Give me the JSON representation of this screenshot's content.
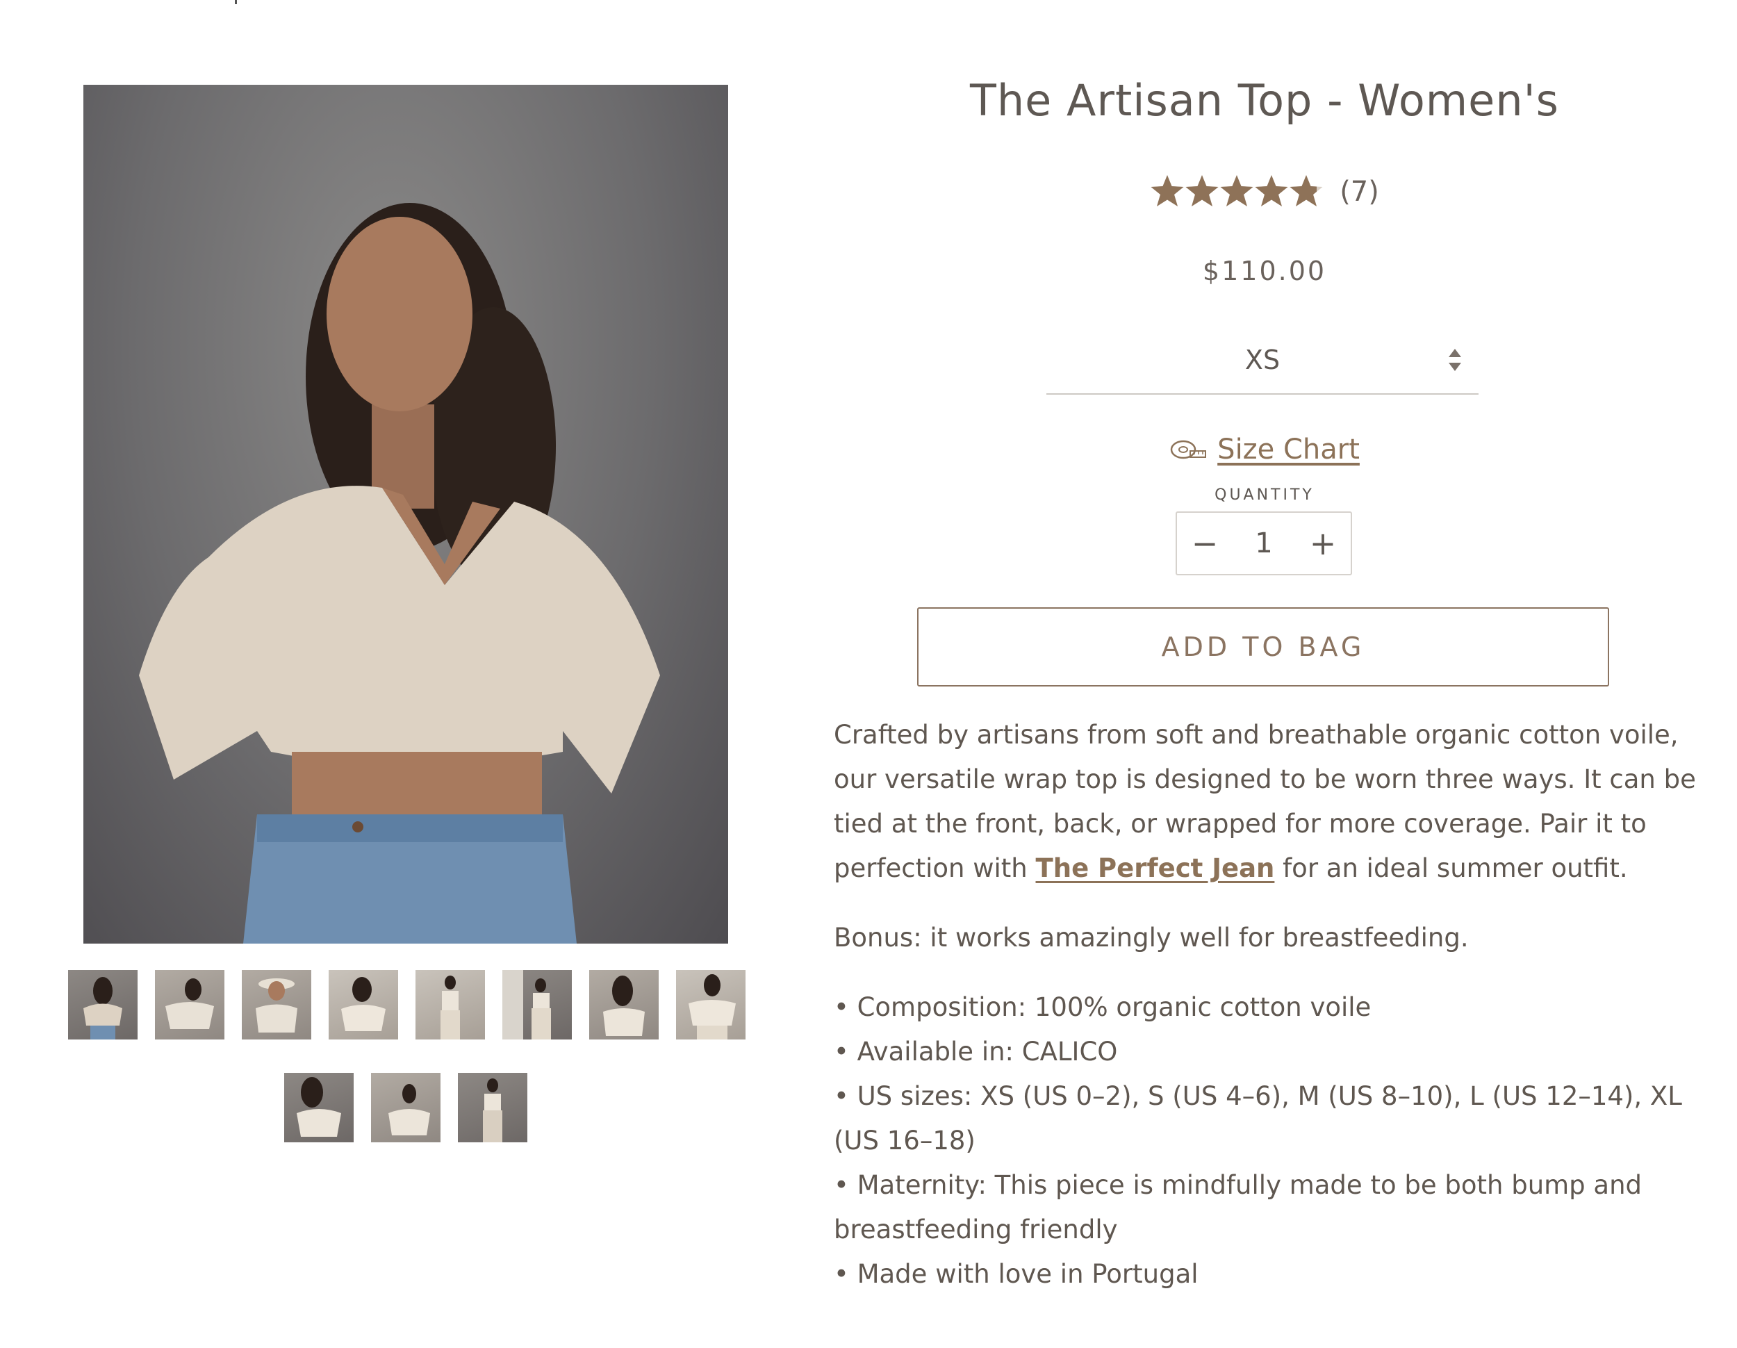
{
  "product": {
    "title": "The Artisan Top - Women's",
    "rating": {
      "value": 4.8,
      "max": 5,
      "count": "(7)"
    },
    "price": "$110.00",
    "size": {
      "selected": "XS"
    },
    "size_chart_label": "Size Chart",
    "quantity": {
      "label": "QUANTITY",
      "value": "1",
      "decrement": "−",
      "increment": "+"
    },
    "add_to_bag_label": "ADD TO BAG"
  },
  "description": {
    "paragraph1": {
      "text_before": "Crafted by artisans from soft and breathable organic cotton voile, our versatile wrap top is designed to be worn three ways. It can be tied at the front, back, or wrapped for more coverage. Pair it to perfection with ",
      "link": "The Perfect Jean",
      "text_after": " for an ideal summer outfit."
    },
    "paragraph2": "Bonus: it works amazingly well for breastfeeding.",
    "bullets": [
      "• Composition: 100% organic cotton voile",
      "• Available in: CALICO",
      "• US sizes: XS (US 0–2), S (US 4–6), M (US 8–10), L (US 12–14), XL (US 16–18)",
      "• Maternity: This piece is mindfully made to be both bump and breastfeeding friendly",
      "• Made with love in Portugal"
    ]
  },
  "colors": {
    "accent": "#8b7461",
    "link": "#8c7258",
    "star": "#8e7258",
    "text": "#5f5750"
  },
  "icons": {
    "size_chart": "measuring-tape-icon",
    "select": "up-down-arrows-icon",
    "rating": "star-icon"
  }
}
